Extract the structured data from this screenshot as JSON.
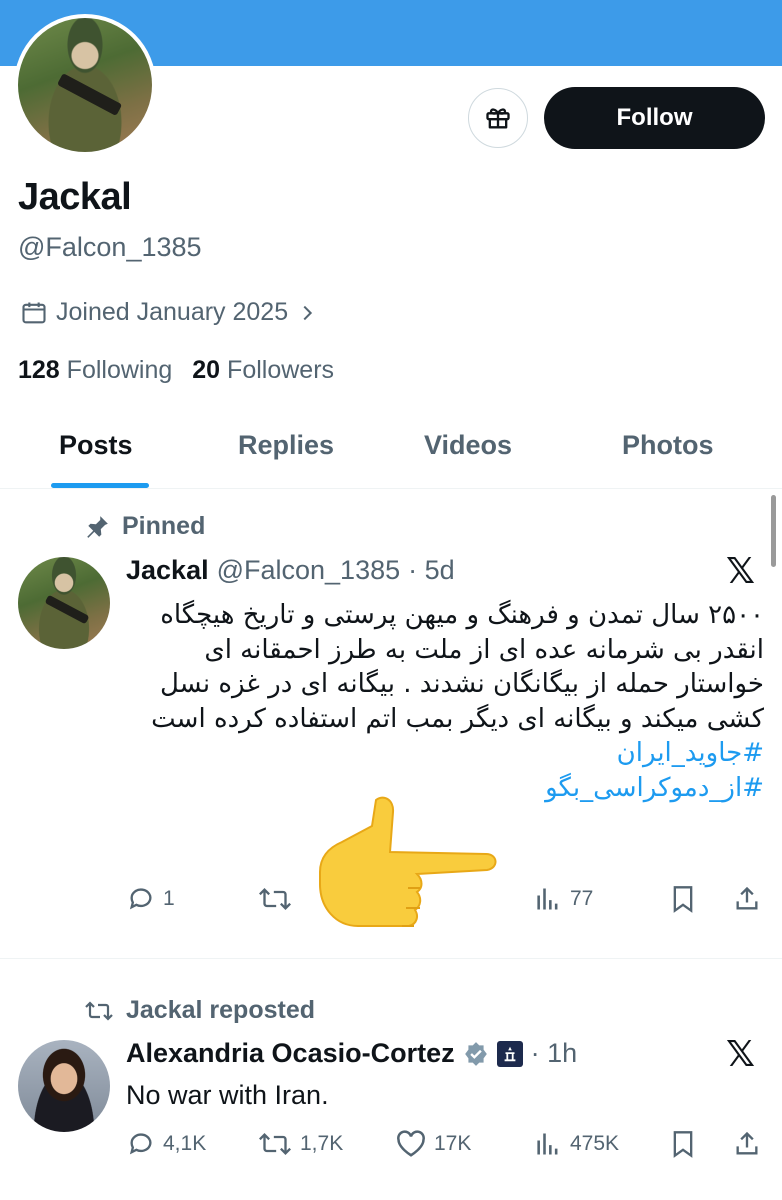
{
  "profile": {
    "name": "Jackal",
    "handle": "@Falcon_1385",
    "joined": "Joined January 2025",
    "following_count": "128",
    "following_label": "Following",
    "followers_count": "20",
    "followers_label": "Followers",
    "follow_button": "Follow"
  },
  "tabs": [
    {
      "label": "Posts",
      "active": true
    },
    {
      "label": "Replies",
      "active": false
    },
    {
      "label": "Videos",
      "active": false
    },
    {
      "label": "Photos",
      "active": false
    }
  ],
  "pinned_tweet": {
    "pinned_label": "Pinned",
    "author": "Jackal",
    "handle": "@Falcon_1385",
    "time": "· 5d",
    "text": "۲۵۰۰ سال تمدن و فرهنگ و میهن پرستی و تاریخ هیچگاه انقدر بی شرمانه عده ای از ملت به طرز احمقانه ای خواستار حمله از بیگانگان نشدند . بیگانه ای در غزه نسل کشی میکند و بیگانه ای دیگر بمب اتم استفاده کرده است",
    "hashtag1": "#جاوید_ایران",
    "hashtag2": "#از_دموکراسی_بگو",
    "replies": "1",
    "views": "77"
  },
  "repost": {
    "repost_label": "Jackal reposted",
    "author": "Alexandria Ocasio-Cortez",
    "time": "· 1h",
    "text": "No war with Iran.",
    "replies": "4,1K",
    "reposts": "1,7K",
    "likes": "17K",
    "views": "475K"
  },
  "colors": {
    "banner": "#3d9be9",
    "accent": "#1d9bf0",
    "muted": "#536471",
    "text": "#0f1419"
  }
}
